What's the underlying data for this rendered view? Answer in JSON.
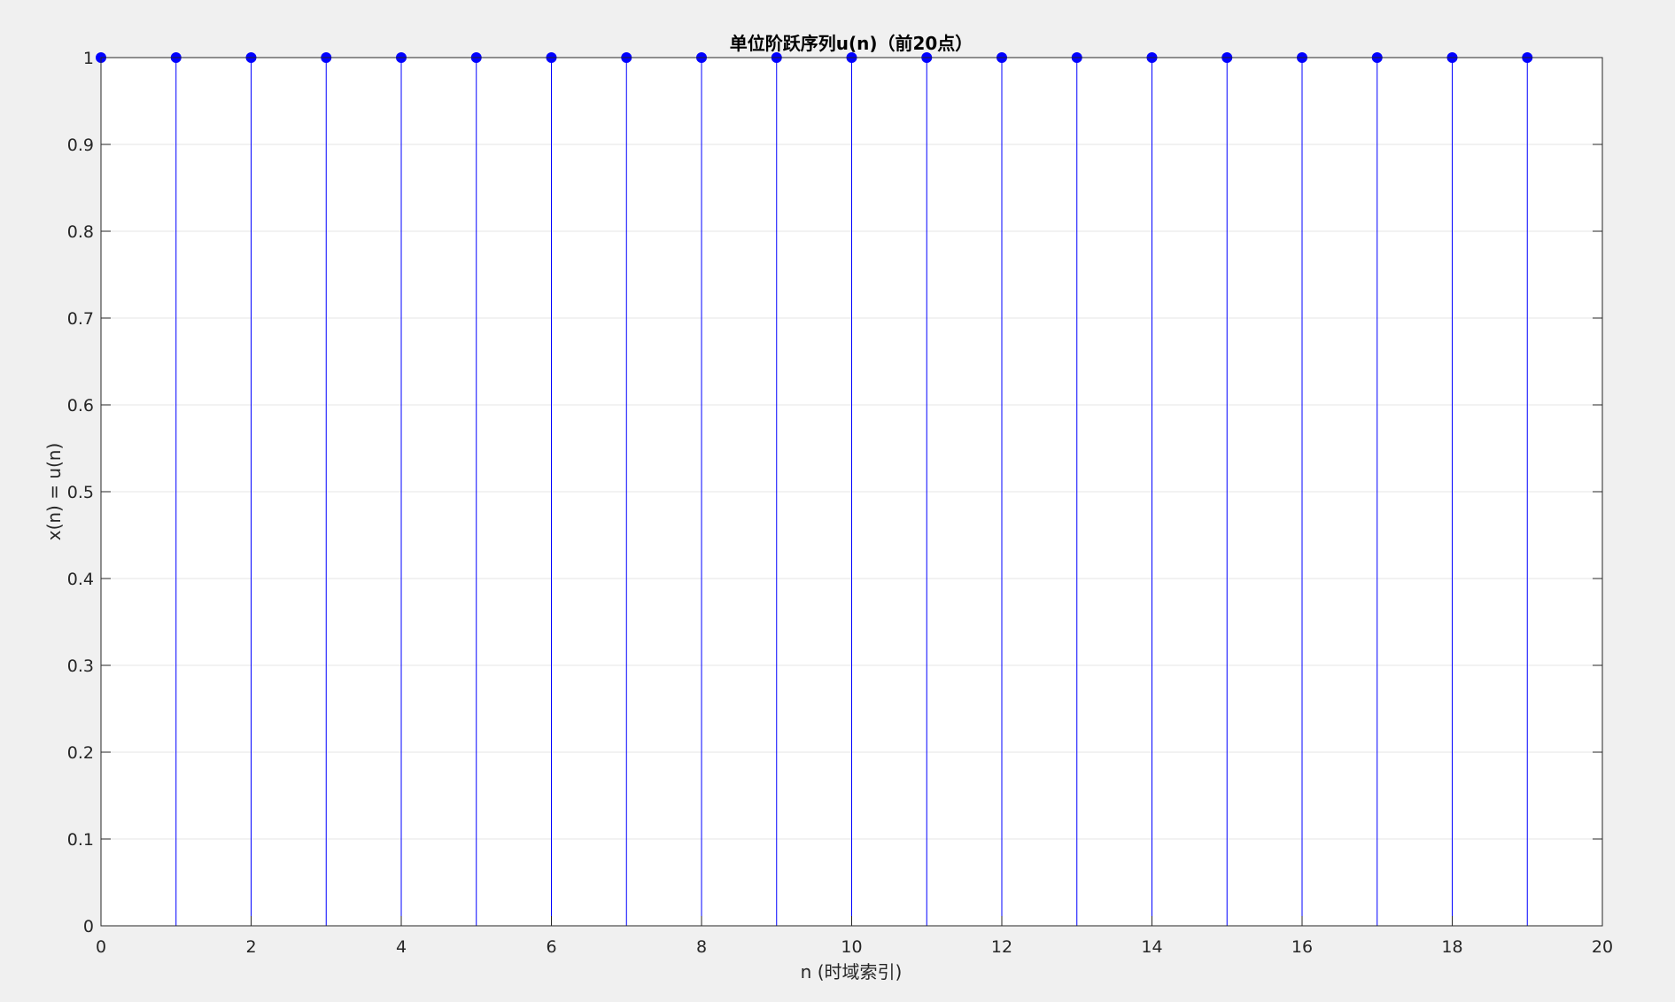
{
  "chart_data": {
    "type": "stem",
    "title": "单位阶跃序列u(n)（前20点）",
    "xlabel": "n (时域索引)",
    "ylabel": "x(n) = u(n)",
    "xlim": [
      0,
      20
    ],
    "ylim": [
      0,
      1
    ],
    "xticks": [
      0,
      2,
      4,
      6,
      8,
      10,
      12,
      14,
      16,
      18,
      20
    ],
    "yticks": [
      0,
      0.1,
      0.2,
      0.3,
      0.4,
      0.5,
      0.6,
      0.7,
      0.8,
      0.9,
      1
    ],
    "ytick_labels": [
      "0",
      "0.1",
      "0.2",
      "0.3",
      "0.4",
      "0.5",
      "0.6",
      "0.7",
      "0.8",
      "0.9",
      "1"
    ],
    "grid": true,
    "series": [
      {
        "x": [
          0,
          1,
          2,
          3,
          4,
          5,
          6,
          7,
          8,
          9,
          10,
          11,
          12,
          13,
          14,
          15,
          16,
          17,
          18,
          19
        ],
        "values": [
          1,
          1,
          1,
          1,
          1,
          1,
          1,
          1,
          1,
          1,
          1,
          1,
          1,
          1,
          1,
          1,
          1,
          1,
          1,
          1
        ]
      }
    ],
    "colors": {
      "series": "#0000ff",
      "axes": "#262626",
      "grid": "#e6e6e6",
      "plot_bg": "#ffffff",
      "figure_bg": "#f0f0f0"
    }
  }
}
